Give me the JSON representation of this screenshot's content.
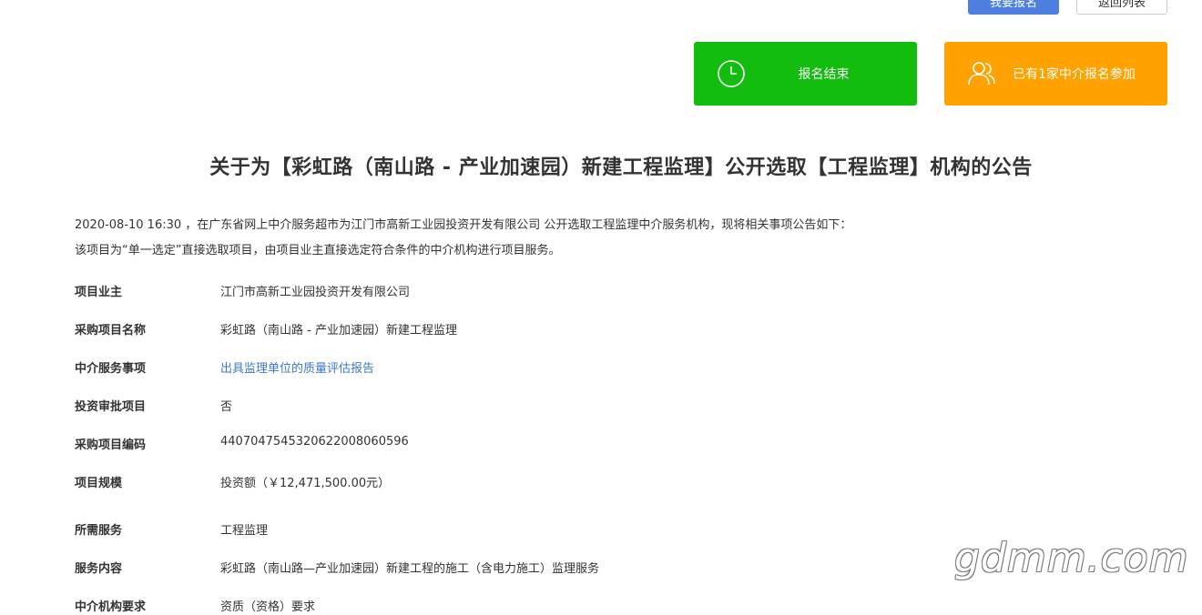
{
  "header": {
    "primary_btn": "我要报名",
    "secondary_btn": "返回列表"
  },
  "status": {
    "ended_label": "报名结束",
    "participants_label": "已有1家中介报名参加"
  },
  "title": "关于为【彩虹路（南山路 - 产业加速园）新建工程监理】公开选取【工程监理】机构的公告",
  "intro": {
    "line1": "2020-08-10 16:30 ，在广东省网上中介服务超市为江门市高新工业园投资开发有限公司 公开选取工程监理中介服务机构，现将相关事项公告如下：",
    "line2": "该项目为“单一选定”直接选取项目，由项目业主直接选定符合条件的中介机构进行项目服务。"
  },
  "details": [
    {
      "key": "项目业主",
      "value": "江门市高新工业园投资开发有限公司"
    },
    {
      "key": "采购项目名称",
      "value": "彩虹路（南山路 - 产业加速园）新建工程监理"
    },
    {
      "key": "中介服务事项",
      "value": "出具监理单位的质量评估报告"
    },
    {
      "key": "投资审批项目",
      "value": "否"
    },
    {
      "key": "采购项目编码",
      "value": "440704754532062200806059​6"
    },
    {
      "key": "项目规模",
      "value": "投资额（￥12,471,500.00元）"
    },
    {
      "key": "所需服务",
      "value": "工程监理"
    },
    {
      "key": "服务内容",
      "value": "彩虹路（南山路—产业加速园）新建工程的施工（含电力施工）监理服务"
    },
    {
      "key": "中介机构要求",
      "value": "资质（资格）要求"
    }
  ],
  "watermark": "gdmm.com",
  "colors": {
    "green": "#13bd0f",
    "orange": "#ffa200",
    "link": "#3c78c8",
    "primary": "#4e7fe0"
  },
  "icons": {
    "ended": "clock-icon",
    "participants": "users-icon"
  }
}
